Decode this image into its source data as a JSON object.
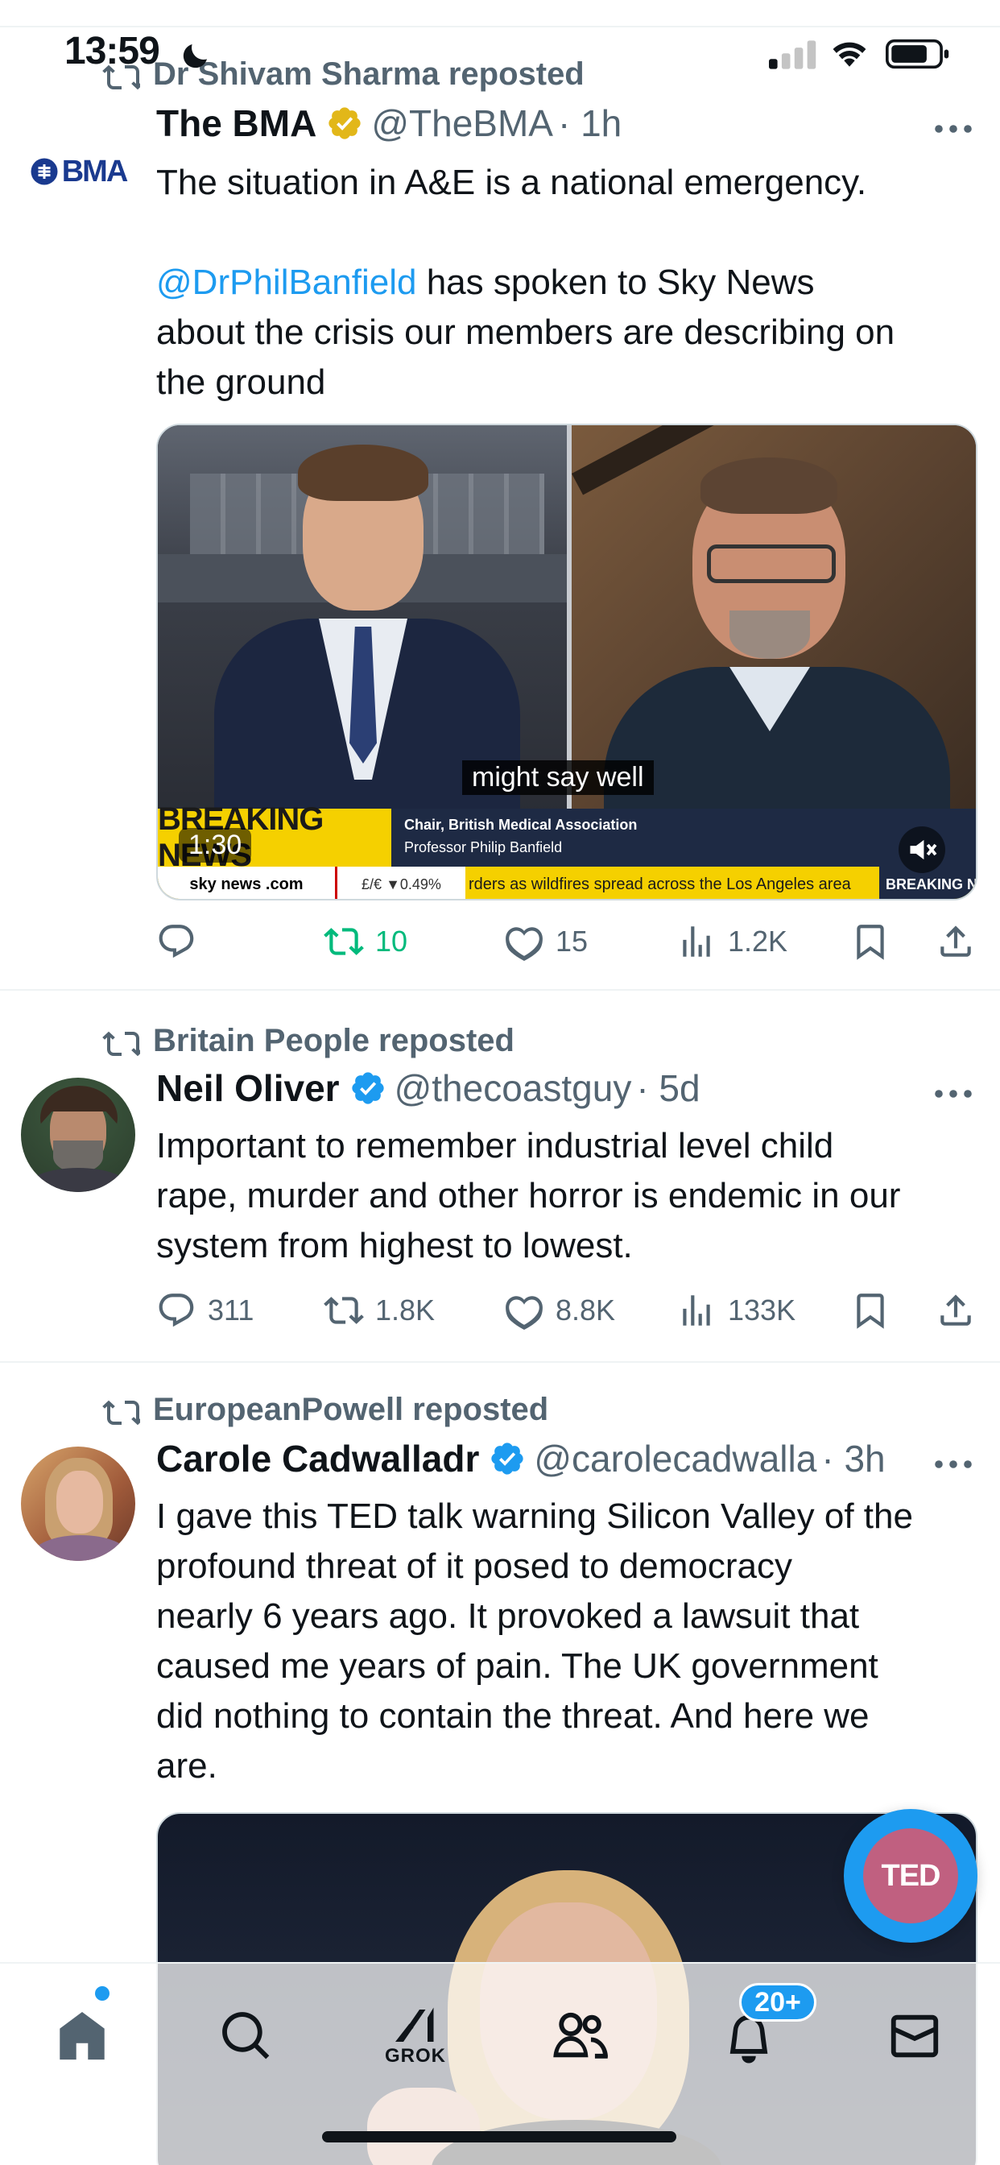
{
  "status_bar": {
    "time": "13:59",
    "moon_icon": "moon-icon",
    "signal_icon": "cellular-signal-icon",
    "wifi_icon": "wifi-icon",
    "battery_icon": "battery-icon"
  },
  "posts": [
    {
      "reposted_by": "Dr Shivam Sharma reposted",
      "display_name": "The BMA",
      "handle": "@TheBMA",
      "time": "· 1h",
      "verified": "gold",
      "avatar_text": "BMA",
      "text_line1": "The situation in A&E is a national emergency.",
      "mention": "@DrPhilBanfield",
      "text_after_mention": " has spoken to Sky News",
      "text_line3": "about the crisis our members are describing on",
      "text_line4": "the ground",
      "video": {
        "subtitle": "might say well",
        "ticker_title": "BREAKING NEWS",
        "caption_role": "Chair, British Medical Association",
        "caption_name": "Professor Philip Banfield",
        "channel": "sky news .com",
        "market": "£/€ ▼0.49%",
        "ticker_text": "rders as wildfires spread across the Los Angeles area",
        "ticker_tail": "BREAKING N",
        "duration": "1:30"
      },
      "actions": {
        "replies": "",
        "reposts": "10",
        "likes": "15",
        "views": "1.2K"
      }
    },
    {
      "reposted_by": "Britain People reposted",
      "display_name": "Neil Oliver",
      "handle": "@thecoastguy",
      "time": "· 5d",
      "verified": "blue",
      "text_line1": "Important to remember industrial level child",
      "text_line2": "rape, murder and other horror is endemic in our",
      "text_line3": "system from highest to lowest.",
      "actions": {
        "replies": "311",
        "reposts": "1.8K",
        "likes": "8.8K",
        "views": "133K"
      }
    },
    {
      "reposted_by": "EuropeanPowell reposted",
      "display_name": "Carole Cadwalladr",
      "handle": "@carolecadwalla",
      "time": "· 3h",
      "verified": "blue",
      "text_line1": "I gave this TED talk warning Silicon Valley of the",
      "text_line2": "profound threat of it posed to democracy",
      "text_line3": "nearly 6 years ago. It provoked a lawsuit that",
      "text_line4": "caused me years of pain. The UK government",
      "text_line5": "did nothing to contain the threat. And here we",
      "text_line6": "are."
    }
  ],
  "fab": {
    "label": "TED"
  },
  "nav": {
    "items": [
      "home-icon",
      "search-icon",
      "grok-icon",
      "communities-icon",
      "notifications-icon",
      "messages-icon"
    ],
    "grok_label": "GROK",
    "notification_badge": "20+"
  },
  "colors": {
    "accent": "#1d9bf0",
    "repost_green": "#00ba7c",
    "secondary_text": "#536471",
    "gold_verified": "#e2b719"
  }
}
